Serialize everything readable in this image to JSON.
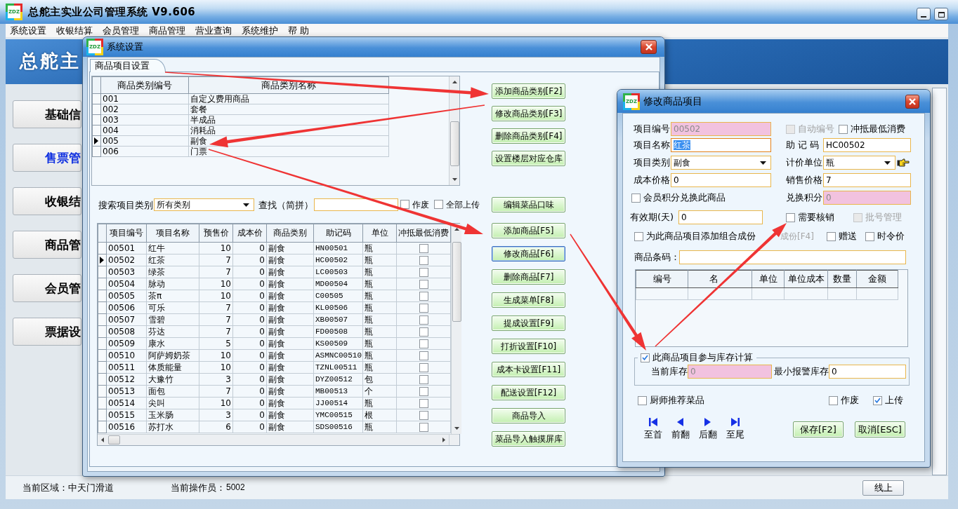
{
  "main_window": {
    "logo": "ZDZ",
    "title": "总舵主实业公司管理系统 V9.606",
    "menu": [
      "系统设置",
      "收银结算",
      "会员管理",
      "商品管理",
      "营业查询",
      "系统维护",
      "帮 助"
    ],
    "banner": "总舵主",
    "sidebar": [
      {
        "label": "基础信",
        "selected": false
      },
      {
        "label": "售票管",
        "selected": true
      },
      {
        "label": "收银结",
        "selected": false
      },
      {
        "label": "商品管",
        "selected": false
      },
      {
        "label": "会员管",
        "selected": false
      },
      {
        "label": "票据设",
        "selected": false
      }
    ],
    "status_bar": {
      "area": "当前区域：中天门滑道",
      "operator_label": "当前操作员：",
      "operator": "5002",
      "mode_button": "线上"
    }
  },
  "settings_dialog": {
    "logo": "ZDZ",
    "title": "系统设置",
    "tabs": [
      {
        "label": "商品项目设置",
        "selected": true
      }
    ],
    "category_table": {
      "columns": [
        "商品类别编号",
        "商品类别名称"
      ],
      "rows": [
        {
          "cells": [
            "001",
            "自定义费用商品"
          ],
          "selected": false
        },
        {
          "cells": [
            "002",
            "套餐"
          ],
          "selected": false
        },
        {
          "cells": [
            "003",
            "半成品"
          ],
          "selected": false
        },
        {
          "cells": [
            "004",
            "消耗品"
          ],
          "selected": false
        },
        {
          "cells": [
            "005",
            "副食"
          ],
          "selected": true
        },
        {
          "cells": [
            "006",
            "门票"
          ],
          "selected": false
        }
      ]
    },
    "category_buttons": [
      "添加商品类别[F2]",
      "修改商品类别[F3]",
      "删除商品类别[F4]",
      "设置楼层对应仓库"
    ],
    "search": {
      "category_label": "搜索项目类别",
      "category": "所有类别",
      "find_label": "查找（简拼）",
      "options": [
        {
          "label": "作废",
          "checked": false
        },
        {
          "label": "全部上传",
          "checked": false
        }
      ]
    },
    "flavor_button": "编辑菜品口味",
    "product_buttons": [
      {
        "label": "添加商品[F5]",
        "focused": false
      },
      {
        "label": "修改商品[F6]",
        "focused": true
      },
      {
        "label": "删除商品[F7]",
        "focused": false
      },
      {
        "label": "生成菜单[F8]",
        "focused": false
      },
      {
        "label": "提成设置[F9]",
        "focused": false
      },
      {
        "label": "打折设置[F10]",
        "focused": false
      },
      {
        "label": "成本卡设置[F11]",
        "focused": false
      },
      {
        "label": "配送设置[F12]",
        "focused": false
      },
      {
        "label": "商品导入",
        "focused": false
      },
      {
        "label": "菜品导入触摸屏库",
        "focused": false
      }
    ],
    "product_table": {
      "columns": [
        "项目编号",
        "项目名称",
        "预售价",
        "成本价",
        "商品类别",
        "助记码",
        "单位",
        "冲抵最低消费"
      ],
      "rows": [
        {
          "cells": [
            "00501",
            "红牛",
            "10",
            "0",
            "副食",
            "HN00501",
            "瓶"
          ],
          "offset_min": false,
          "selected": false
        },
        {
          "cells": [
            "00502",
            "红茶",
            "7",
            "0",
            "副食",
            "HC00502",
            "瓶"
          ],
          "offset_min": false,
          "selected": true
        },
        {
          "cells": [
            "00503",
            "绿茶",
            "7",
            "0",
            "副食",
            "LC00503",
            "瓶"
          ],
          "offset_min": false,
          "selected": false
        },
        {
          "cells": [
            "00504",
            "脉动",
            "10",
            "0",
            "副食",
            "MD00504",
            "瓶"
          ],
          "offset_min": false,
          "selected": false
        },
        {
          "cells": [
            "00505",
            "茶π",
            "10",
            "0",
            "副食",
            "C00505",
            "瓶"
          ],
          "offset_min": false,
          "selected": false
        },
        {
          "cells": [
            "00506",
            "可乐",
            "7",
            "0",
            "副食",
            "KL00506",
            "瓶"
          ],
          "offset_min": false,
          "selected": false
        },
        {
          "cells": [
            "00507",
            "雪碧",
            "7",
            "0",
            "副食",
            "XB00507",
            "瓶"
          ],
          "offset_min": false,
          "selected": false
        },
        {
          "cells": [
            "00508",
            "芬达",
            "7",
            "0",
            "副食",
            "FD00508",
            "瓶"
          ],
          "offset_min": false,
          "selected": false
        },
        {
          "cells": [
            "00509",
            "康水",
            "5",
            "0",
            "副食",
            "KS00509",
            "瓶"
          ],
          "offset_min": false,
          "selected": false
        },
        {
          "cells": [
            "00510",
            "阿萨姆奶茶",
            "10",
            "0",
            "副食",
            "ASMNC00510",
            "瓶"
          ],
          "offset_min": false,
          "selected": false
        },
        {
          "cells": [
            "00511",
            "体质能量",
            "10",
            "0",
            "副食",
            "TZNL00511",
            "瓶"
          ],
          "offset_min": false,
          "selected": false
        },
        {
          "cells": [
            "00512",
            "大豫竹",
            "3",
            "0",
            "副食",
            "DYZ00512",
            "包"
          ],
          "offset_min": false,
          "selected": false
        },
        {
          "cells": [
            "00513",
            "面包",
            "7",
            "0",
            "副食",
            "MB00513",
            "个"
          ],
          "offset_min": false,
          "selected": false
        },
        {
          "cells": [
            "00514",
            "尖叫",
            "10",
            "0",
            "副食",
            "JJ00514",
            "瓶"
          ],
          "offset_min": false,
          "selected": false
        },
        {
          "cells": [
            "00515",
            "玉米肠",
            "3",
            "0",
            "副食",
            "YMC00515",
            "根"
          ],
          "offset_min": false,
          "selected": false
        },
        {
          "cells": [
            "00516",
            "苏打水",
            "6",
            "0",
            "副食",
            "SDS00516",
            "瓶"
          ],
          "offset_min": false,
          "selected": false
        }
      ]
    }
  },
  "edit_dialog": {
    "logo": "ZDZ",
    "title": "修改商品项目",
    "code": {
      "label": "项目编号",
      "value": "00502",
      "readonly": true
    },
    "auto_number": {
      "label": "自动编号",
      "checked": false,
      "disabled": true
    },
    "offset_min": {
      "label": "冲抵最低消费",
      "checked": false
    },
    "name": {
      "label": "项目名称",
      "value": "红茶",
      "highlighted": true
    },
    "mnemonic": {
      "label": "助 记 码",
      "value": "HC00502"
    },
    "category": {
      "label": "项目类别",
      "value": "副食"
    },
    "unit": {
      "label": "计价单位",
      "value": "瓶"
    },
    "cost": {
      "label": "成本价格",
      "value": "0"
    },
    "price": {
      "label": "销售价格",
      "value": "7"
    },
    "points_exchange": {
      "label": "会员积分兑换此商品",
      "checked": false
    },
    "points": {
      "label": "兑换积分",
      "value": "0",
      "readonly": true
    },
    "validity": {
      "label": "有效期(天)",
      "value": "0"
    },
    "verify": {
      "label": "需要核销",
      "checked": false
    },
    "batch": {
      "label": "批号管理",
      "checked": false,
      "disabled": true
    },
    "combo": {
      "label": "为此商品项目添加组合成份",
      "checked": false
    },
    "add_component": {
      "label": "成份[F4]",
      "disabled": true
    },
    "gift": {
      "label": "赠送",
      "checked": false
    },
    "seasonal": {
      "label": "时令价",
      "checked": false
    },
    "barcode": {
      "label": "商品条码："
    },
    "component_table": {
      "columns": [
        "编号",
        "名",
        "单位",
        "单位成本",
        "数量",
        "金额"
      ]
    },
    "stock": {
      "checkbox": {
        "label": "此商品项目参与库存计算",
        "checked": true
      },
      "current": {
        "label": "当前库存",
        "value": "0",
        "readonly": true
      },
      "minimum": {
        "label": "最小报警库存",
        "value": "0"
      }
    },
    "chef": {
      "label": "厨师推荐菜品",
      "checked": false
    },
    "void": {
      "label": "作废",
      "checked": false
    },
    "upload": {
      "label": "上传",
      "checked": true
    },
    "nav": [
      {
        "kind": "first",
        "label": "至首"
      },
      {
        "kind": "prev",
        "label": "前翻"
      },
      {
        "kind": "next",
        "label": "后翻"
      },
      {
        "kind": "last",
        "label": "至尾"
      }
    ],
    "buttons": [
      "保存[F2]",
      "取消[ESC]"
    ]
  }
}
